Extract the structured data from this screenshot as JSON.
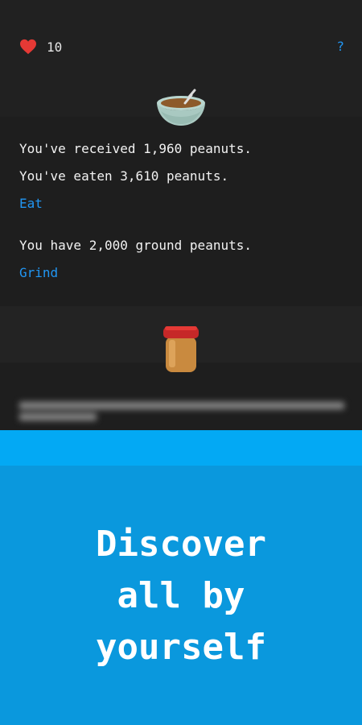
{
  "hud": {
    "lives": "10",
    "help_label": "?"
  },
  "stats": {
    "received": "You've received 1,960 peanuts.",
    "eaten": "You've eaten 3,610 peanuts.",
    "eat_label": "Eat",
    "ground": "You have 2,000 ground peanuts.",
    "grind_label": "Grind"
  },
  "promo": {
    "line1": "Discover",
    "line2": "all by",
    "line3": "yourself"
  },
  "colors": {
    "accent": "#2196f3",
    "promo_bg": "#0a98dd",
    "promo_strip": "#03a9f4",
    "heart": "#e53935"
  }
}
